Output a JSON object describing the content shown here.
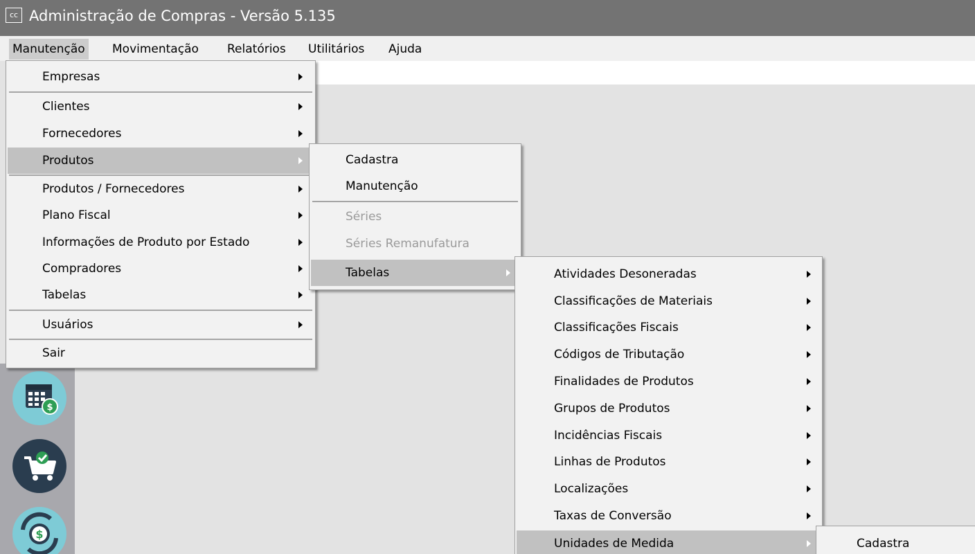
{
  "window": {
    "icon_text": "cc",
    "title": "Administração de Compras - Versão 5.135"
  },
  "menubar": {
    "items": [
      "Manutenção",
      "Movimentação",
      "Relatórios",
      "Utilitários",
      "Ajuda"
    ]
  },
  "menu_manutencao": {
    "items": [
      {
        "label": "Empresas"
      },
      {
        "label": "Clientes"
      },
      {
        "label": "Fornecedores"
      },
      {
        "label": "Produtos"
      },
      {
        "label": "Produtos / Fornecedores"
      },
      {
        "label": "Plano Fiscal"
      },
      {
        "label": "Informações de Produto por Estado"
      },
      {
        "label": "Compradores"
      },
      {
        "label": "Tabelas"
      },
      {
        "label": "Usuários"
      },
      {
        "label": "Sair"
      }
    ]
  },
  "menu_produtos": {
    "items": [
      {
        "label": "Cadastra"
      },
      {
        "label": "Manutenção"
      },
      {
        "label": "Séries"
      },
      {
        "label": "Séries Remanufatura"
      },
      {
        "label": "Tabelas"
      }
    ]
  },
  "menu_tabelas": {
    "items": [
      {
        "label": "Atividades Desoneradas"
      },
      {
        "label": "Classificações de Materiais"
      },
      {
        "label": "Classificações Fiscais"
      },
      {
        "label": "Códigos de Tributação"
      },
      {
        "label": "Finalidades de Produtos"
      },
      {
        "label": "Grupos de Produtos"
      },
      {
        "label": "Incidências Fiscais"
      },
      {
        "label": "Linhas de Produtos"
      },
      {
        "label": "Localizações"
      },
      {
        "label": "Taxas de Conversão"
      },
      {
        "label": "Unidades de Medida"
      }
    ]
  },
  "menu_unidades": {
    "items": [
      {
        "label": "Cadastra"
      }
    ]
  },
  "dock": {
    "buttons": [
      "calendar-money-icon",
      "cart-check-icon",
      "money-exchange-icon"
    ]
  },
  "colors": {
    "titlebar": "#737373",
    "menu_highlight": "#c1c1c1",
    "dock_bg": "#a8a8ad",
    "icon_teal": "#7ecbd6",
    "icon_dark": "#2a3d4f",
    "icon_green": "#2e9e54"
  }
}
